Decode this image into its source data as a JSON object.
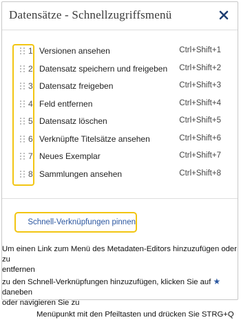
{
  "dialog": {
    "title": "Datensätze - Schnellzugriffsmenü",
    "close_icon": "close-icon"
  },
  "menu": {
    "items": [
      {
        "number": "1",
        "label": "Versionen ansehen",
        "shortcut": "Ctrl+Shift+1"
      },
      {
        "number": "2",
        "label": "Datensatz speichern und freigeben",
        "shortcut": "Ctrl+Shift+2"
      },
      {
        "number": "3",
        "label": "Datensatz freigeben",
        "shortcut": "Ctrl+Shift+3"
      },
      {
        "number": "4",
        "label": "Feld entfernen",
        "shortcut": "Ctrl+Shift+4"
      },
      {
        "number": "5",
        "label": "Datensatz löschen",
        "shortcut": "Ctrl+Shift+5"
      },
      {
        "number": "6",
        "label": "Verknüpfte Titelsätze ansehen",
        "shortcut": "Ctrl+Shift+6"
      },
      {
        "number": "7",
        "label": "Neues Exemplar",
        "shortcut": "Ctrl+Shift+7"
      },
      {
        "number": "8",
        "label": "Sammlungen ansehen",
        "shortcut": "Ctrl+Shift+8"
      }
    ],
    "handle_icon": "drag-handle-icon"
  },
  "pin_button": {
    "label": "Schnell-Verknüpfungen pinnen",
    "icon": "pin-icon"
  },
  "help": {
    "line1": "Um einen Link zum Menü des Metadaten-Editors hinzuzufügen oder zu",
    "line2": "entfernen",
    "line3_before": "zu den Schnell-Verknüpfungen hinzuzufügen, klicken Sie auf",
    "line3_after": "daneben",
    "line3b": "oder navigieren Sie zu",
    "line4": "Menüpunkt mit den Pfeiltasten und drücken Sie STRG+Q",
    "star_icon": "star-icon"
  },
  "colors": {
    "highlight": "#f2c512",
    "accent_blue": "#2b57a0",
    "close_blue": "#1f3f73"
  }
}
